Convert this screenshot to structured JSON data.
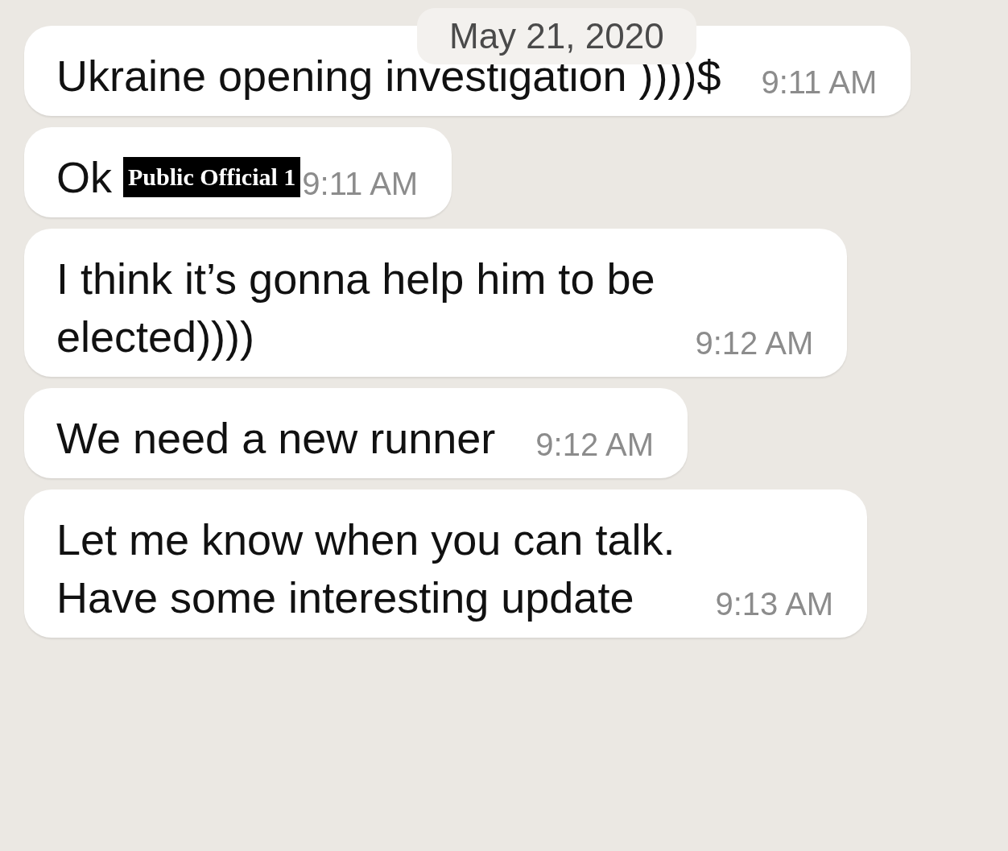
{
  "date_divider": "May 21, 2020",
  "messages": [
    {
      "text": "Ukraine opening investigation ))))$",
      "time": "9:11 AM"
    },
    {
      "text": "Ok",
      "annotation": "Public Official 1",
      "time": "9:11 AM"
    },
    {
      "text": "I think it’s gonna help him to be\nelected))))",
      "time": "9:12 AM"
    },
    {
      "text": "We need a new runner",
      "time": "9:12 AM"
    },
    {
      "text": "Let me know when you can talk.\nHave some interesting update",
      "time": "9:13 AM"
    }
  ]
}
